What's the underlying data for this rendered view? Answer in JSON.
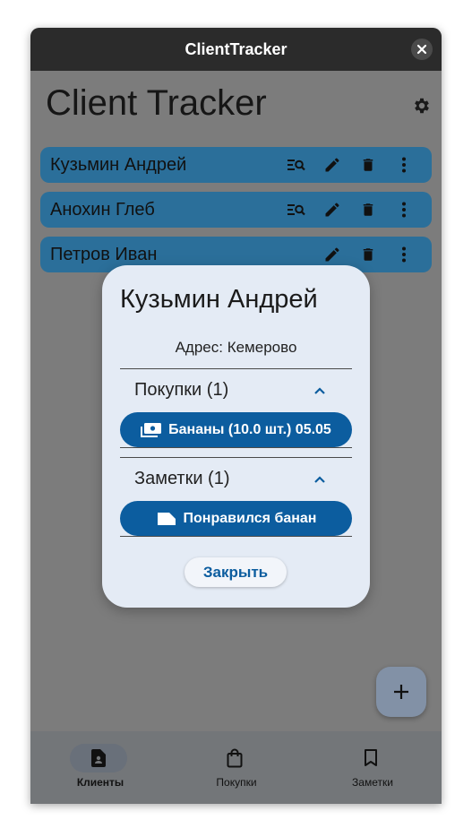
{
  "window": {
    "title": "ClientTracker"
  },
  "app": {
    "title": "Client Tracker"
  },
  "clients": [
    {
      "name": "Кузьмин Андрей"
    },
    {
      "name": "Анохин Глеб"
    },
    {
      "name": "Петров Иван"
    }
  ],
  "dialog": {
    "title": "Кузьмин Андрей",
    "address": "Адрес: Кемерово",
    "purchases_title": "Покупки (1)",
    "purchase_item": "Бананы (10.0 шт.) 05.05",
    "notes_title": "Заметки (1)",
    "note_item": "Понравился банан",
    "close_label": "Закрыть"
  },
  "nav": {
    "items": [
      {
        "label": "Клиенты",
        "icon": "client-doc-icon",
        "selected": true
      },
      {
        "label": "Покупки",
        "icon": "shopping-bag-icon",
        "selected": false
      },
      {
        "label": "Заметки",
        "icon": "bookmark-icon",
        "selected": false
      }
    ]
  },
  "fab": {
    "icon": "plus-icon"
  },
  "colors": {
    "accent": "#0c5d9f",
    "row": "#2b6f9a",
    "dialog_bg": "#e4ebf5",
    "scrim": "#7c7c7c"
  }
}
